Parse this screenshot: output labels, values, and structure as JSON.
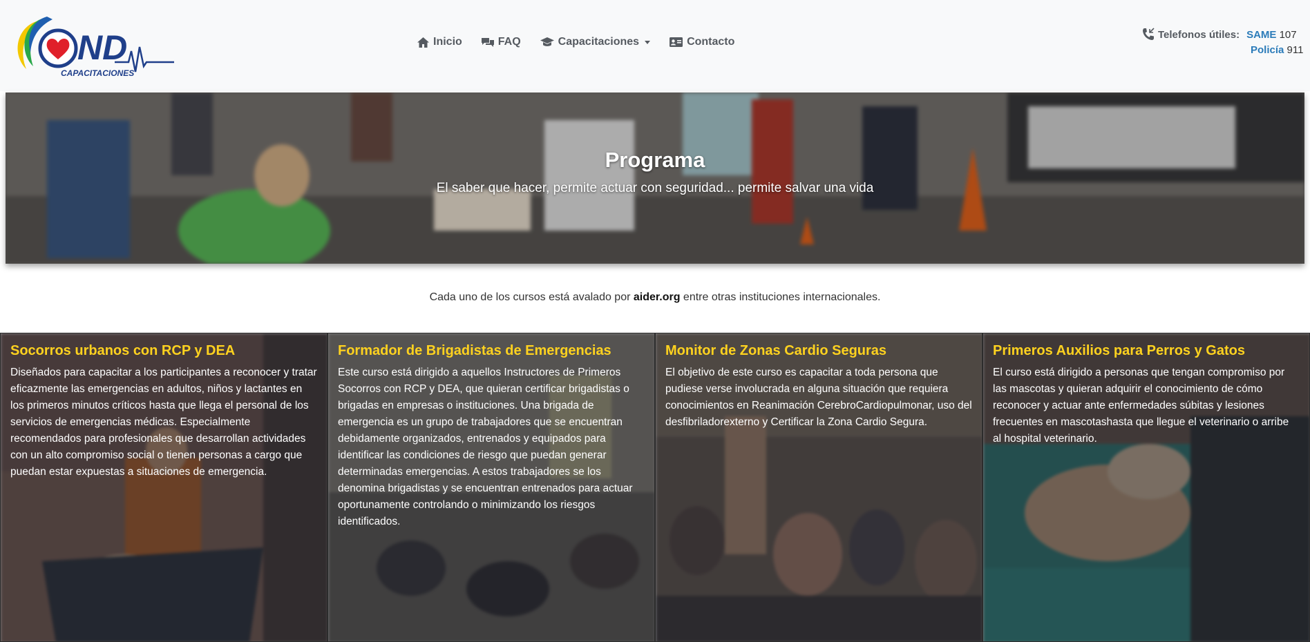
{
  "brand": {
    "logo_mark": "ND",
    "logo_sub": "CAPACITACIONES"
  },
  "nav": {
    "items": [
      {
        "label": "Inicio",
        "icon": "home-icon"
      },
      {
        "label": "FAQ",
        "icon": "comments-icon"
      },
      {
        "label": "Capacitaciones",
        "icon": "graduation-cap-icon"
      },
      {
        "label": "Contacto",
        "icon": "address-card-icon"
      }
    ]
  },
  "phones": {
    "label": "Telefonos útiles:",
    "entries": [
      {
        "name": "SAME",
        "number": "107"
      },
      {
        "name": "Policía",
        "number": "911"
      }
    ]
  },
  "hero": {
    "title": "Programa",
    "subtitle": "El saber que hacer, permite actuar con seguridad... permite salvar una vida"
  },
  "aval": {
    "prefix": "Cada uno de los cursos está avalado por",
    "org": "aider.org",
    "suffix": "entre otras instituciones internacionales."
  },
  "cards": [
    {
      "title": "Socorros urbanos con RCP y DEA",
      "text": "Diseñados para capacitar a los participantes a reconocer y tratar eficazmente las emergencias en adultos, niños y lactantes en los primeros minutos críticos hasta que llega el personal de los servicios de emergencias médicas. Especialmente recomendados para profesionales que desarrollan actividades con un alto compromiso social o tienen personas a cargo que puedan estar expuestas a situaciones de emergencia."
    },
    {
      "title": "Formador de Brigadistas de Emergencias",
      "text": "Este curso está dirigido a aquellos Instructores de Primeros Socorros con RCP y DEA, que quieran certificar brigadistas o brigadas en empresas o instituciones. Una brigada de emergencia es un grupo de trabajadores que se encuentran debidamente organizados, entrenados y equipados para identificar las condiciones de riesgo que puedan generar determinadas emergencias. A estos trabajadores se los denomina brigadistas y se encuentran entrenados para actuar oportunamente controlando o minimizando los riesgos identificados."
    },
    {
      "title": "Monitor de Zonas Cardio Seguras",
      "text": "El objetivo de este curso es capacitar a toda persona que pudiese verse involucrada en alguna situación que requiera conocimientos en Reanimación CerebroCardiopulmonar, uso del desfibriladorexterno y Certificar la Zona Cardio Segura."
    },
    {
      "title": "Primeros Auxilios para Perros y Gatos",
      "text": "El curso está dirigido a personas que tengan compromiso por las mascotas y quieran adquirir el conocimiento de cómo reconocer y actuar ante enfermedades súbitas y lesiones frecuentes en mascotashasta que llegue el veterinario o arribe al hospital veterinario."
    }
  ]
}
